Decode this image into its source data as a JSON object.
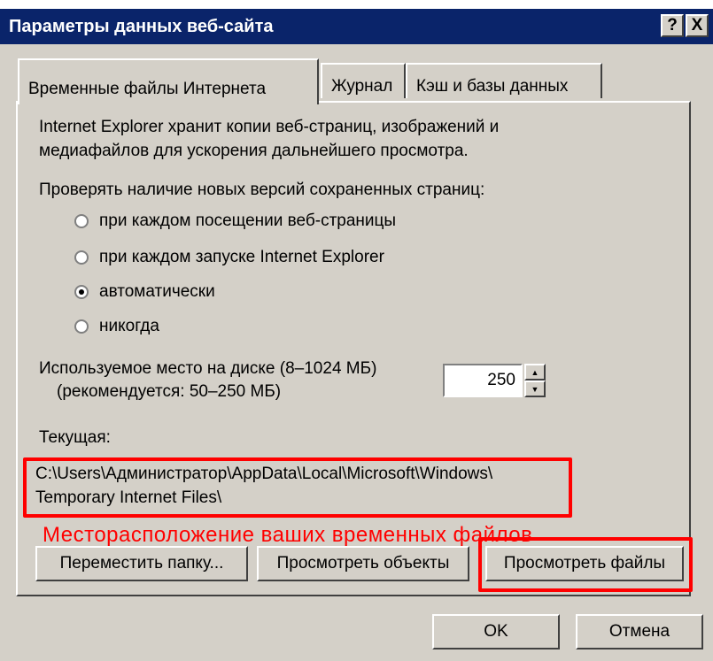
{
  "window": {
    "title": "Параметры данных веб-сайта",
    "help_glyph": "?",
    "close_glyph": "X"
  },
  "tabs": [
    {
      "label": "Временные файлы Интернета",
      "active": true
    },
    {
      "label": "Журнал",
      "active": false
    },
    {
      "label": "Кэш и базы данных",
      "active": false
    }
  ],
  "panel": {
    "description_line1": "Internet Explorer хранит копии веб-страниц, изображений и",
    "description_line2": "медиафайлов для ускорения дальнейшего просмотра.",
    "check_label": "Проверять наличие новых версий сохраненных страниц:",
    "options": [
      {
        "label": "при каждом посещении веб-страницы",
        "selected": false
      },
      {
        "label": "при каждом запуске Internet Explorer",
        "selected": false
      },
      {
        "label": "автоматически",
        "selected": true
      },
      {
        "label": "никогда",
        "selected": false
      }
    ],
    "disk_label_line1": "Используемое место на диске (8–1024 МБ)",
    "disk_label_line2": "(рекомендуется: 50–250 МБ)",
    "disk_value": "250",
    "current_label": "Текущая:",
    "path_line1": "C:\\Users\\Администратор\\AppData\\Local\\Microsoft\\Windows\\",
    "path_line2": "Temporary Internet Files\\",
    "annotation": "Месторасположение ваших временных файлов",
    "buttons": {
      "move_folder": "Переместить папку...",
      "view_objects": "Просмотреть объекты",
      "view_files": "Просмотреть файлы"
    }
  },
  "footer": {
    "ok": "OK",
    "cancel": "Отмена"
  },
  "colors": {
    "titlebar": "#0a246a",
    "face": "#d4d0c8",
    "highlight": "#ff0000"
  }
}
